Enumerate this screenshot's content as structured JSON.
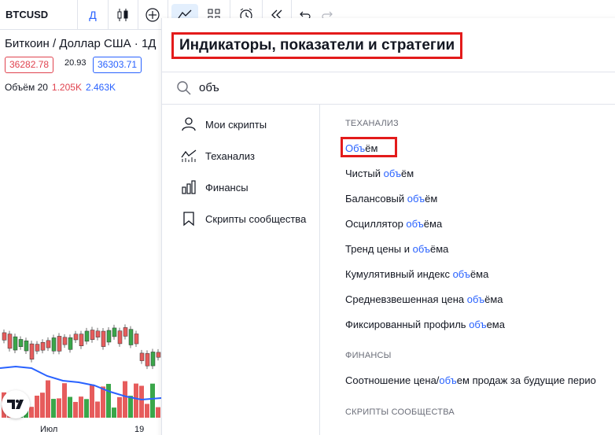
{
  "toolbar": {
    "symbol": "BTCUSD",
    "interval": "Д",
    "icons": [
      "candles-icon",
      "add-circle-icon",
      "indicators-icon",
      "layouts-icon",
      "alert-clock-icon",
      "replay-icon",
      "undo-icon",
      "redo-icon"
    ]
  },
  "chart": {
    "symbol_title": "Биткоин / Доллар США · 1Д",
    "sell_price": "36282.78",
    "spread": "20.93",
    "buy_price": "36303.71",
    "volume_label": "Объём 20",
    "volume_value_1": "1.205K",
    "volume_value_2": "2.463K",
    "x_label_1": "Июл",
    "x_label_2": "19",
    "colors": {
      "up": "#26a69a",
      "down": "#ef5350",
      "volume_up": "#3aa64a",
      "volume_down": "#e65c5c",
      "ma_line": "#2962ff"
    }
  },
  "dialog": {
    "title": "Индикаторы, показатели и стратегии",
    "search_value": "объ",
    "nav": [
      {
        "label": "Мои скрипты",
        "icon": "user-icon"
      },
      {
        "label": "Теханализ",
        "icon": "technicals-icon"
      },
      {
        "label": "Финансы",
        "icon": "financials-icon"
      },
      {
        "label": "Скрипты сообщества",
        "icon": "bookmark-icon"
      }
    ],
    "sections": {
      "technicals": "ТЕХАНАЛИЗ",
      "financials": "ФИНАНСЫ",
      "community": "СКРИПТЫ СООБЩЕСТВА"
    },
    "results": [
      {
        "pre": "",
        "hl": "Объ",
        "post": "ём"
      },
      {
        "pre": "Чистый ",
        "hl": "объ",
        "post": "ём"
      },
      {
        "pre": "Балансовый ",
        "hl": "объ",
        "post": "ём"
      },
      {
        "pre": "Осциллятор ",
        "hl": "объ",
        "post": "ёма"
      },
      {
        "pre": "Тренд цены и ",
        "hl": "объ",
        "post": "ёма"
      },
      {
        "pre": "Кумулятивный индекс ",
        "hl": "объ",
        "post": "ёма"
      },
      {
        "pre": "Средневзвешенная цена ",
        "hl": "объ",
        "post": "ёма"
      },
      {
        "pre": "Фиксированный профиль ",
        "hl": "объ",
        "post": "ема"
      }
    ],
    "finance_result": {
      "pre": "Соотношение цена/",
      "hl": "объ",
      "post": "ем продаж за будущие перио"
    }
  }
}
